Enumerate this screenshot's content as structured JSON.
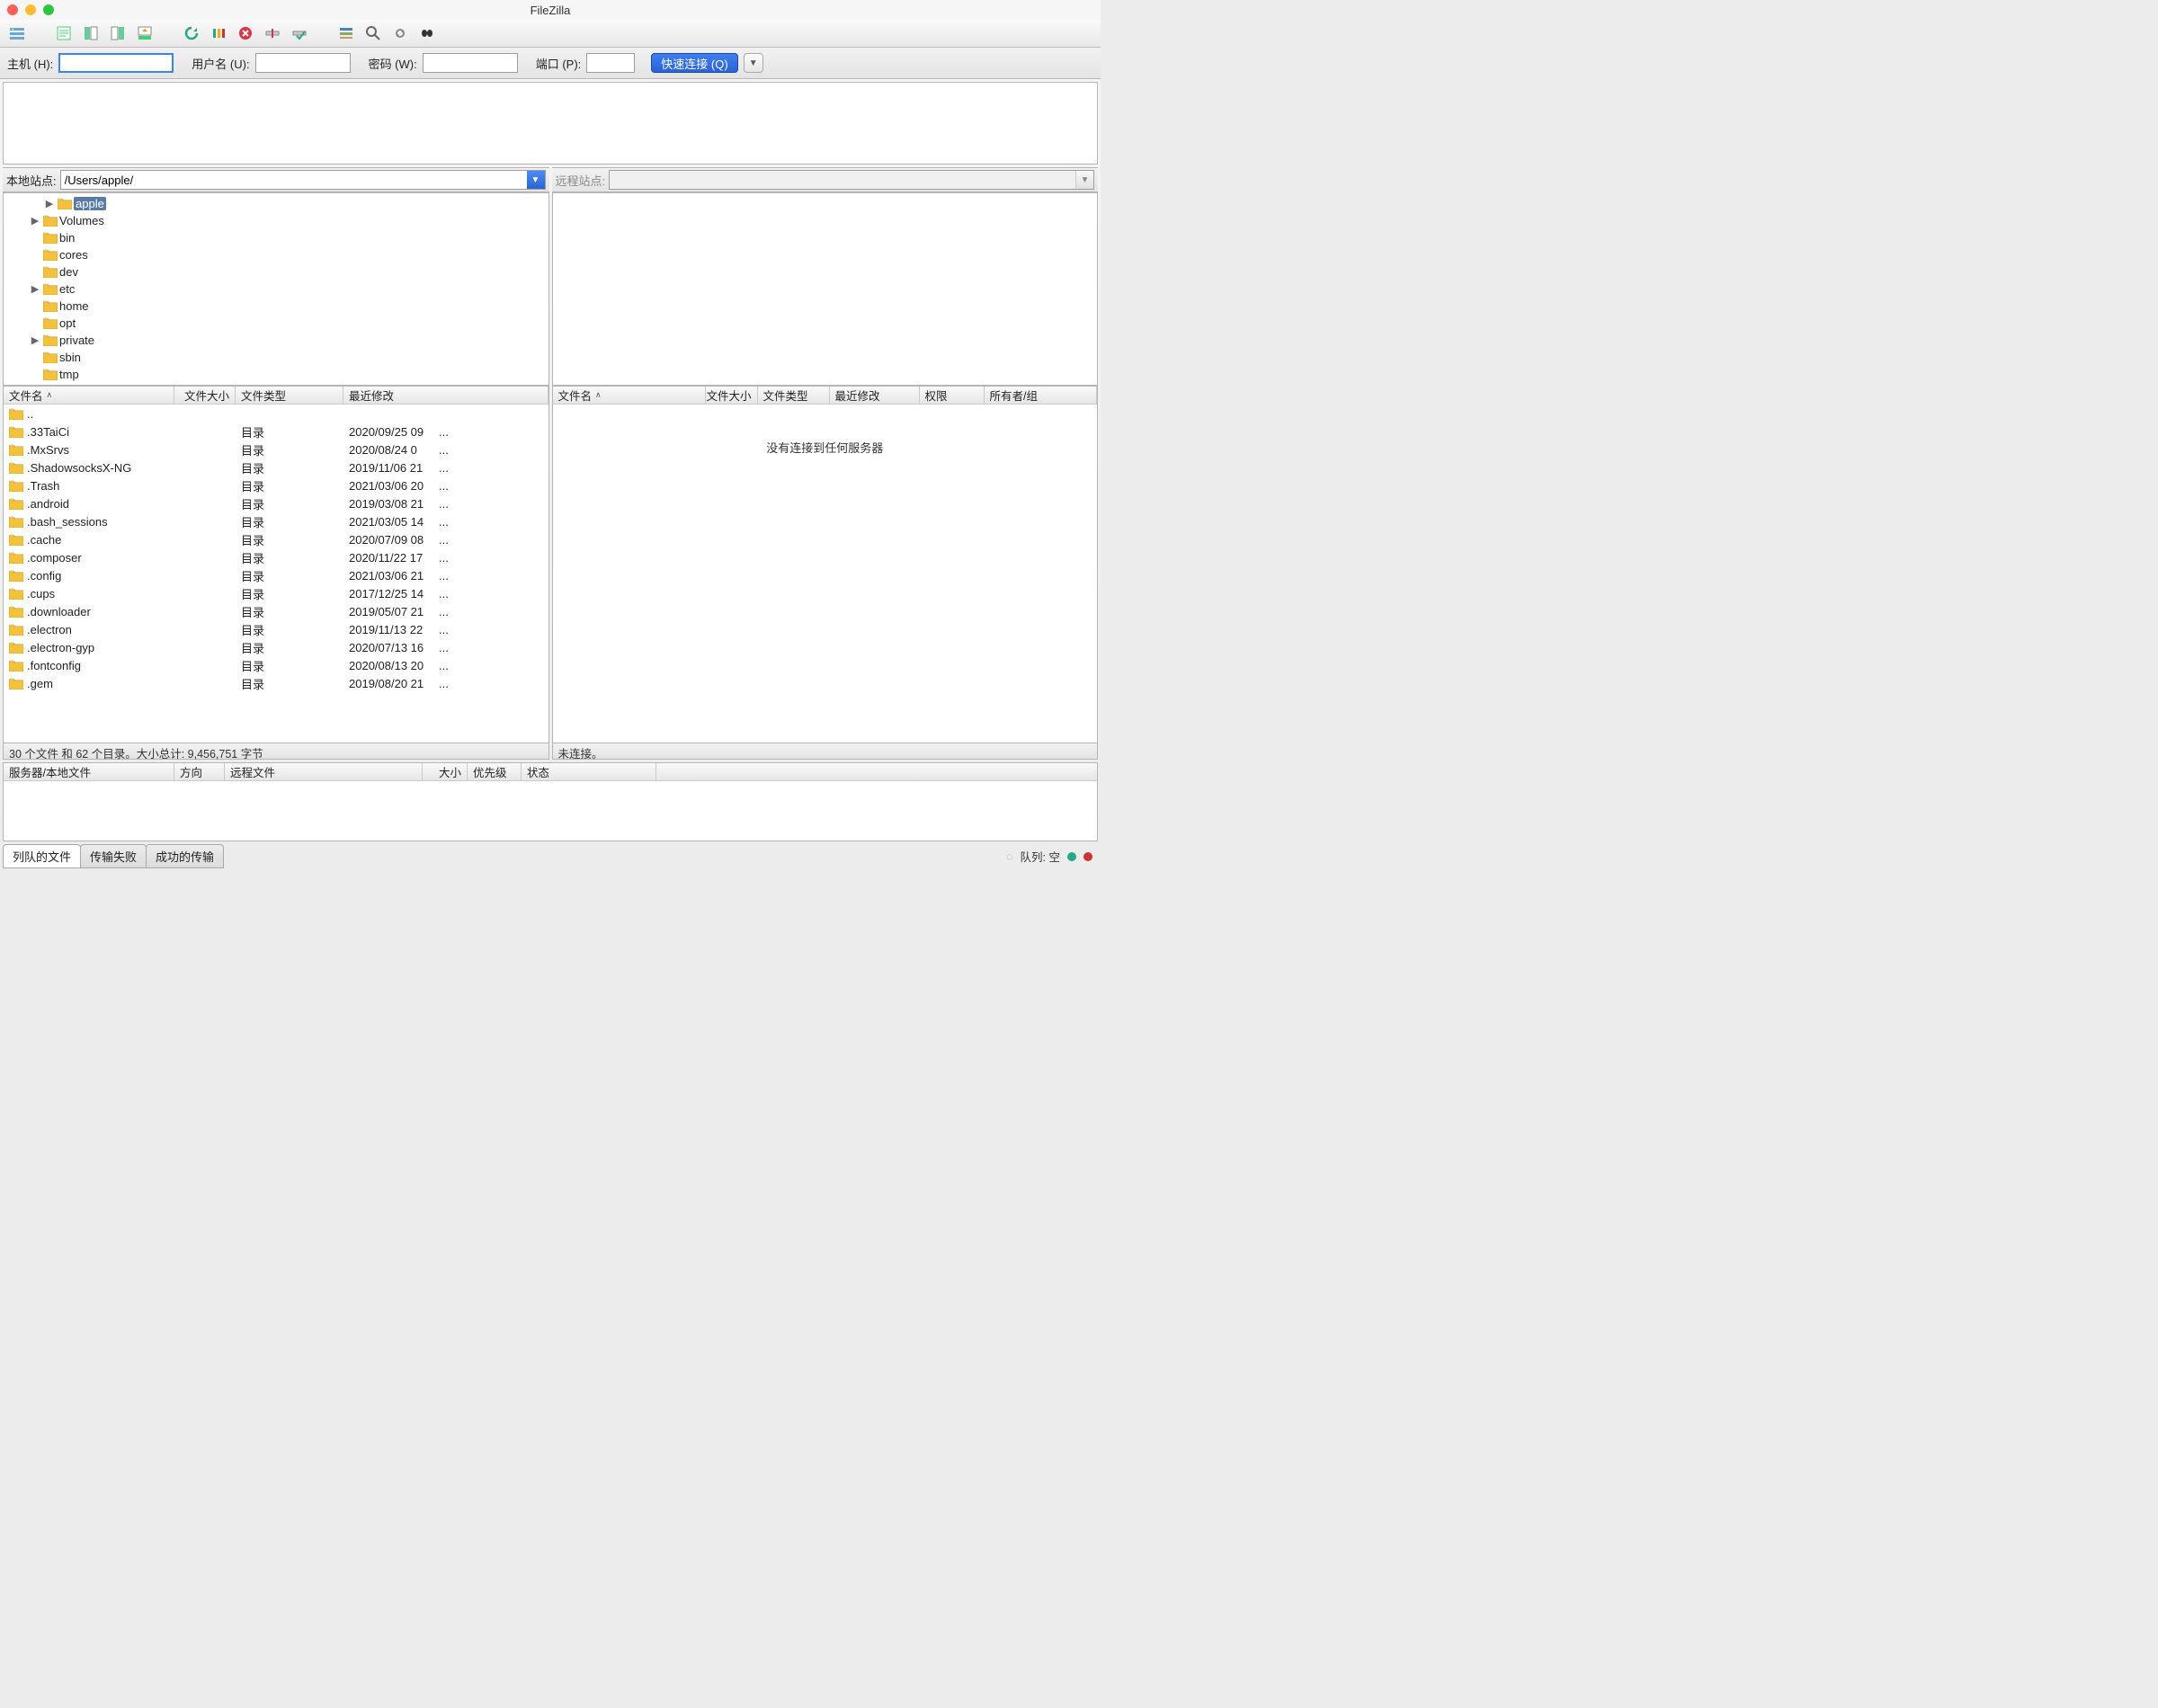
{
  "window": {
    "title": "FileZilla"
  },
  "quickconnect": {
    "host_label": "主机 (H):",
    "user_label": "用户名 (U):",
    "pass_label": "密码 (W):",
    "port_label": "端口 (P):",
    "button": "快速连接 (Q)"
  },
  "local_site": {
    "label": "本地站点:",
    "path": "/Users/apple/"
  },
  "remote_site": {
    "label": "远程站点:",
    "path": ""
  },
  "tree_local": [
    {
      "name": "apple",
      "indent": 2,
      "exp": true,
      "sel": true
    },
    {
      "name": "Volumes",
      "indent": 1,
      "exp": true
    },
    {
      "name": "bin",
      "indent": 1
    },
    {
      "name": "cores",
      "indent": 1
    },
    {
      "name": "dev",
      "indent": 1
    },
    {
      "name": "etc",
      "indent": 1,
      "exp": true
    },
    {
      "name": "home",
      "indent": 1
    },
    {
      "name": "opt",
      "indent": 1
    },
    {
      "name": "private",
      "indent": 1,
      "exp": true
    },
    {
      "name": "sbin",
      "indent": 1
    },
    {
      "name": "tmp",
      "indent": 1
    }
  ],
  "list_headers_local": {
    "name": "文件名",
    "size": "文件大小",
    "type": "文件类型",
    "modified": "最近修改"
  },
  "list_headers_remote": {
    "name": "文件名",
    "size": "文件大小",
    "type": "文件类型",
    "modified": "最近修改",
    "perm": "权限",
    "owner": "所有者/组"
  },
  "local_files": [
    {
      "name": "..",
      "type": "",
      "mod": ""
    },
    {
      "name": ".33TaiCi",
      "type": "目录",
      "mod": "2020/09/25 09",
      "ext": "..."
    },
    {
      "name": ".MxSrvs",
      "type": "目录",
      "mod": "2020/08/24 0",
      "ext": "..."
    },
    {
      "name": ".ShadowsocksX-NG",
      "type": "目录",
      "mod": "2019/11/06 21",
      "ext": "..."
    },
    {
      "name": ".Trash",
      "type": "目录",
      "mod": "2021/03/06 20",
      "ext": "..."
    },
    {
      "name": ".android",
      "type": "目录",
      "mod": "2019/03/08 21",
      "ext": "..."
    },
    {
      "name": ".bash_sessions",
      "type": "目录",
      "mod": "2021/03/05 14",
      "ext": "..."
    },
    {
      "name": ".cache",
      "type": "目录",
      "mod": "2020/07/09 08",
      "ext": "..."
    },
    {
      "name": ".composer",
      "type": "目录",
      "mod": "2020/11/22 17",
      "ext": "..."
    },
    {
      "name": ".config",
      "type": "目录",
      "mod": "2021/03/06 21",
      "ext": "..."
    },
    {
      "name": ".cups",
      "type": "目录",
      "mod": "2017/12/25 14",
      "ext": "..."
    },
    {
      "name": ".downloader",
      "type": "目录",
      "mod": "2019/05/07 21",
      "ext": "..."
    },
    {
      "name": ".electron",
      "type": "目录",
      "mod": "2019/11/13 22",
      "ext": "..."
    },
    {
      "name": ".electron-gyp",
      "type": "目录",
      "mod": "2020/07/13 16",
      "ext": "..."
    },
    {
      "name": ".fontconfig",
      "type": "目录",
      "mod": "2020/08/13 20",
      "ext": "..."
    },
    {
      "name": ".gem",
      "type": "目录",
      "mod": "2019/08/20 21",
      "ext": "..."
    }
  ],
  "local_status": "30 个文件 和 62 个目录。大小总计: 9,456,751 字节",
  "remote_empty": "没有连接到任何服务器",
  "remote_status": "未连接。",
  "queue_headers": {
    "server": "服务器/本地文件",
    "direction": "方向",
    "remote": "远程文件",
    "size": "大小",
    "priority": "优先级",
    "status": "状态"
  },
  "tabs": {
    "queued": "列队的文件",
    "failed": "传输失败",
    "success": "成功的传输"
  },
  "bottom_status": {
    "queue": "队列: 空"
  },
  "colors": {
    "folder_fill": "#f4c23a",
    "folder_stroke": "#c99a1d"
  }
}
